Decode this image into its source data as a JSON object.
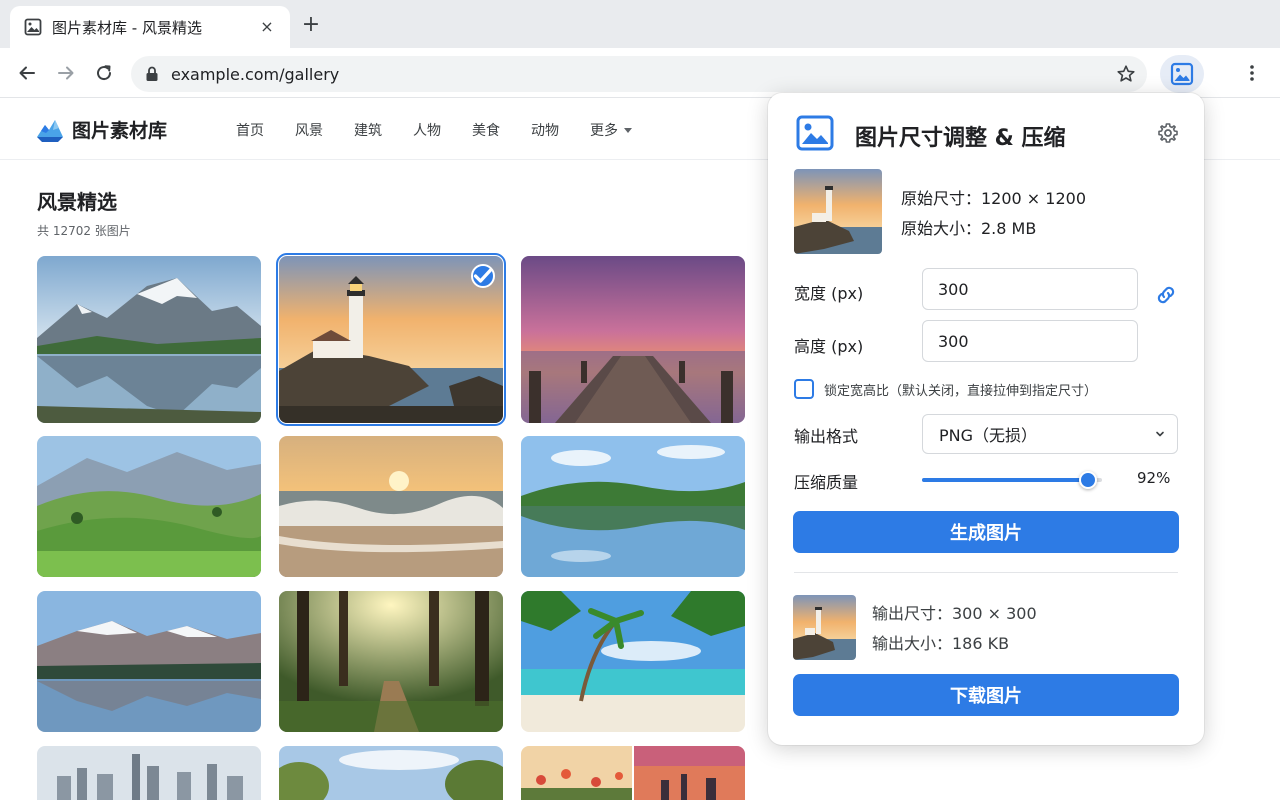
{
  "browser": {
    "tab_title": "图片素材库 - 风景精选",
    "tab_close": "×",
    "new_tab": "+",
    "url": "example.com/gallery"
  },
  "site": {
    "logo_text": "图片素材库",
    "nav": [
      "首页",
      "风景",
      "建筑",
      "人物",
      "美食",
      "动物",
      "更多"
    ]
  },
  "gallery": {
    "title": "风景精选",
    "count": "共 12702 张图片",
    "images": [
      {
        "name": "mountain-lake",
        "selected": false
      },
      {
        "name": "lighthouse",
        "selected": true
      },
      {
        "name": "sunset-pier",
        "selected": false
      },
      {
        "name": "green-hills",
        "selected": false
      },
      {
        "name": "ocean-waves",
        "selected": false
      },
      {
        "name": "lake-reflection",
        "selected": false
      },
      {
        "name": "snow-mountain-lake",
        "selected": false
      },
      {
        "name": "forest-path",
        "selected": false
      },
      {
        "name": "tropical-beach",
        "selected": false
      },
      {
        "name": "city-skyline",
        "selected": false
      },
      {
        "name": "river-trees",
        "selected": false
      },
      {
        "name": "flowers-sunset-city",
        "selected": false
      }
    ]
  },
  "popup": {
    "title": "图片尺寸调整 & 压缩",
    "original_size": "原始尺寸：1200 × 1200",
    "original_filesize": "原始大小：2.8 MB",
    "width_label": "宽度 (px)",
    "width_value": "300",
    "height_label": "高度 (px)",
    "height_value": "300",
    "lock_ratio_label": "锁定宽高比（默认关闭，直接拉伸到指定尺寸）",
    "lock_ratio_checked": false,
    "format_label": "输出格式",
    "format_value": "PNG（无损）",
    "quality_label": "压缩质量",
    "quality_percent": 92,
    "quality_text": "92%",
    "generate_button": "生成图片",
    "output_size": "输出尺寸：300 × 300",
    "output_filesize": "输出大小：186 KB",
    "download_button": "下载图片"
  },
  "colors": {
    "accent": "#2d7be5",
    "text": "#202124",
    "muted": "#5f6368"
  }
}
